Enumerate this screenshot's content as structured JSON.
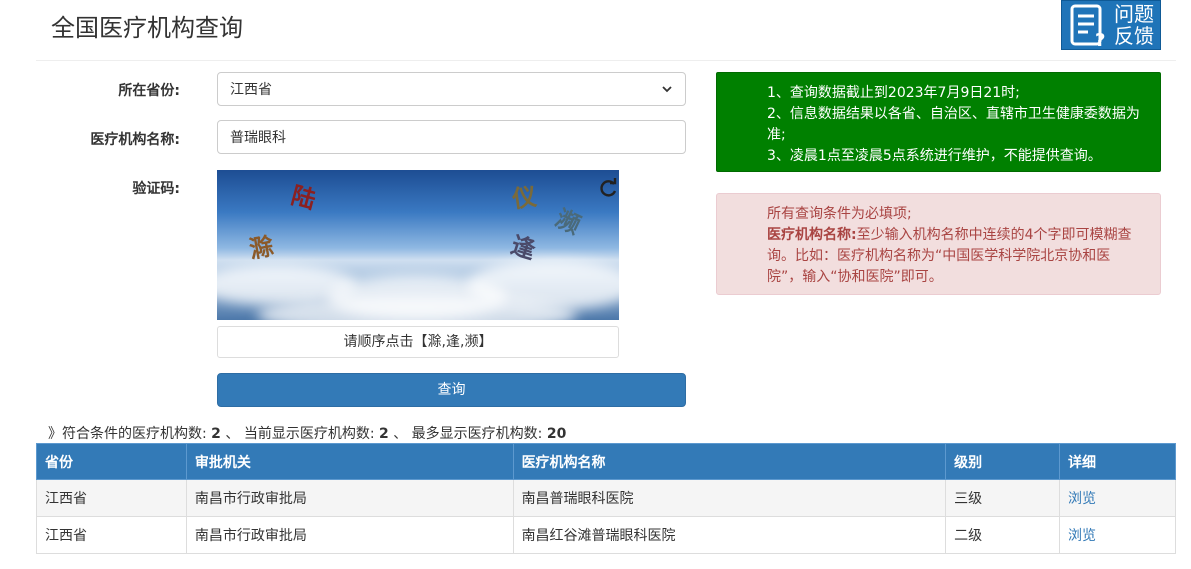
{
  "header": {
    "title": "全国医疗机构查询",
    "feedback": {
      "line1": "问题",
      "line2": "反馈"
    }
  },
  "form": {
    "province_label": "所在省份:",
    "province_value": "江西省",
    "name_label": "医疗机构名称:",
    "name_value": "普瑞眼科",
    "captcha_label": "验证码:",
    "captcha_chars": [
      "陆",
      "仪",
      "濒",
      "滁",
      "逢"
    ],
    "captcha_hint": "请顺序点击【滁,逢,濒】",
    "query_label": "查询"
  },
  "notices": {
    "green": [
      "1、查询数据截止到2023年7月9日21时;",
      "2、信息数据结果以各省、自治区、直辖市卫生健康委数据为准;",
      "3、凌晨1点至凌晨5点系统进行维护，不能提供查询。"
    ],
    "red_line1": "所有查询条件为必填项;",
    "red_bold": "医疗机构名称:",
    "red_rest": "至少输入机构名称中连续的4个字即可模糊查询。比如：医疗机构名称为“中国医学科学院北京协和医院”，输入“协和医院”即可。"
  },
  "summary": {
    "prefix": "》符合条件的医疗机构数:",
    "total": "2",
    "mid1": "、 当前显示医疗机构数:",
    "shown": "2",
    "mid2": "、 最多显示医疗机构数:",
    "max": "20"
  },
  "table": {
    "headers": [
      "省份",
      "审批机关",
      "医疗机构名称",
      "级别",
      "详细"
    ],
    "rows": [
      [
        "江西省",
        "南昌市行政审批局",
        "南昌普瑞眼科医院",
        "三级",
        "浏览"
      ],
      [
        "江西省",
        "南昌市行政审批局",
        "南昌红谷滩普瑞眼科医院",
        "二级",
        "浏览"
      ]
    ]
  },
  "colors": {
    "primary": "#337ab7",
    "green_notice": "#008000",
    "red_notice_bg": "#f2dede",
    "red_notice_text": "#a94442"
  }
}
